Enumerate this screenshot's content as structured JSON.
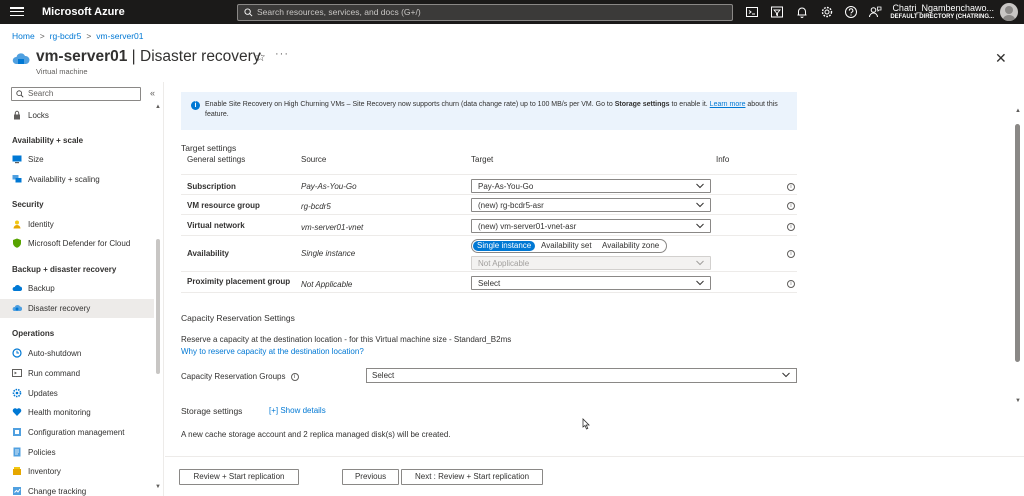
{
  "topbar": {
    "brand": "Microsoft Azure",
    "search_placeholder": "Search resources, services, and docs (G+/)",
    "user_name": "Chatri_Ngambenchawo...",
    "user_directory": "DEFAULT DIRECTORY (CHATRING...",
    "icons": [
      "cloud-shell-icon",
      "directory-filter-icon",
      "notifications-icon",
      "settings-icon",
      "help-icon",
      "feedback-icon"
    ]
  },
  "breadcrumb": [
    "Home",
    "rg-bcdr5",
    "vm-server01"
  ],
  "page": {
    "title_bold": "vm-server01",
    "title_rest": " | Disaster recovery",
    "subtitle": "Virtual machine"
  },
  "sidebar": {
    "search_placeholder": "Search",
    "collapse_label": "«",
    "items": [
      {
        "type": "item",
        "label": "Locks",
        "icon": "lock-icon"
      },
      {
        "type": "group",
        "label": "Availability + scale"
      },
      {
        "type": "item",
        "label": "Size",
        "icon": "size-icon"
      },
      {
        "type": "item",
        "label": "Availability + scaling",
        "icon": "availability-icon"
      },
      {
        "type": "group",
        "label": "Security"
      },
      {
        "type": "item",
        "label": "Identity",
        "icon": "identity-icon"
      },
      {
        "type": "item",
        "label": "Microsoft Defender for Cloud",
        "icon": "defender-shield-icon"
      },
      {
        "type": "group",
        "label": "Backup + disaster recovery"
      },
      {
        "type": "item",
        "label": "Backup",
        "icon": "backup-cloud-icon"
      },
      {
        "type": "item",
        "label": "Disaster recovery",
        "icon": "disaster-recovery-icon",
        "active": true
      },
      {
        "type": "group",
        "label": "Operations"
      },
      {
        "type": "item",
        "label": "Auto-shutdown",
        "icon": "clock-icon"
      },
      {
        "type": "item",
        "label": "Run command",
        "icon": "run-command-icon"
      },
      {
        "type": "item",
        "label": "Updates",
        "icon": "updates-gear-icon"
      },
      {
        "type": "item",
        "label": "Health monitoring",
        "icon": "health-icon"
      },
      {
        "type": "item",
        "label": "Configuration management",
        "icon": "configuration-icon"
      },
      {
        "type": "item",
        "label": "Policies",
        "icon": "policies-icon"
      },
      {
        "type": "item",
        "label": "Inventory",
        "icon": "inventory-icon"
      },
      {
        "type": "item",
        "label": "Change tracking",
        "icon": "change-tracking-icon"
      }
    ]
  },
  "banner": {
    "text_before": "Enable Site Recovery on High Churning VMs – Site Recovery now supports churn (data change rate) up to 100 MB/s per VM. Go to ",
    "bold": "Storage settings",
    "text_after": " to enable it. ",
    "link": "Learn more",
    "text_end": " about this feature."
  },
  "target_settings": {
    "heading": "Target settings",
    "columns": [
      "General settings",
      "Source",
      "Target",
      "Info"
    ],
    "rows": [
      {
        "label": "Subscription",
        "source": "Pay-As-You-Go",
        "target": "Pay-As-You-Go"
      },
      {
        "label": "VM resource group",
        "source": "rg-bcdr5",
        "target": "(new) rg-bcdr5-asr"
      },
      {
        "label": "Virtual network",
        "source": "vm-server01-vnet",
        "target": "(new) vm-server01-vnet-asr"
      },
      {
        "label": "Availability",
        "source": "Single instance",
        "options": [
          "Single instance",
          "Availability set",
          "Availability zone"
        ],
        "selected": "Single instance",
        "secondary": "Not Applicable"
      },
      {
        "label": "Proximity placement group",
        "source": "Not Applicable",
        "target": "Select"
      }
    ]
  },
  "capacity": {
    "heading": "Capacity Reservation Settings",
    "description": "Reserve a capacity at the destination location - for this Virtual machine size - Standard_B2ms",
    "link": "Why to reserve capacity at the destination location?",
    "groups_label": "Capacity Reservation Groups",
    "groups_value": "Select"
  },
  "storage": {
    "heading": "Storage settings",
    "show_details": "[+] Show details",
    "note": "A new cache storage account and 2 replica managed disk(s) will be created."
  },
  "footer": {
    "review_button": "Review + Start replication",
    "previous_button": "Previous",
    "next_button": "Next : Review + Start replication"
  },
  "colors": {
    "accent": "#0078d4",
    "topbar": "#1b1a19",
    "banner_bg": "#ebf3fc"
  }
}
